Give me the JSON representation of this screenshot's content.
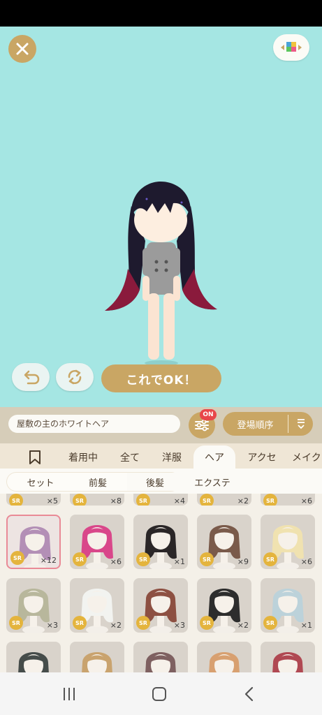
{
  "toolbar": {
    "ok_label": "これでOK！"
  },
  "name_field": {
    "value": "屋敷の主のホワイトヘア"
  },
  "filter": {
    "badge": "ON"
  },
  "sort": {
    "label": "登場順序"
  },
  "tabs": [
    {
      "label": "着用中"
    },
    {
      "label": "全て"
    },
    {
      "label": "洋服"
    },
    {
      "label": "ヘア",
      "active": true
    },
    {
      "label": "アクセ"
    },
    {
      "label": "メイク"
    }
  ],
  "subtabs": [
    {
      "label": "セット"
    },
    {
      "label": "前髪"
    },
    {
      "label": "後髪",
      "active": true
    },
    {
      "label": "エクステ"
    }
  ],
  "items_top": [
    {
      "rarity": "SR",
      "count": "×5"
    },
    {
      "rarity": "SR",
      "count": "×8"
    },
    {
      "rarity": "SR",
      "count": "×4"
    },
    {
      "rarity": "SR",
      "count": "×2"
    },
    {
      "rarity": "SR",
      "count": "×6"
    }
  ],
  "items_row1": [
    {
      "rarity": "SR",
      "count": "×12",
      "hair_color": "#b38fb6",
      "selected": true
    },
    {
      "rarity": "SR",
      "count": "×6",
      "hair_color": "#d9478a"
    },
    {
      "rarity": "SR",
      "count": "×1",
      "hair_color": "#2a2627"
    },
    {
      "rarity": "SR",
      "count": "×9",
      "hair_color": "#7a5a4a"
    },
    {
      "rarity": "SR",
      "count": "×6",
      "hair_color": "#f0e2b0"
    }
  ],
  "items_row2": [
    {
      "rarity": "SR",
      "count": "×3",
      "hair_color": "#b8b79c"
    },
    {
      "rarity": "SR",
      "count": "×2",
      "hair_color": "#f2f3f0"
    },
    {
      "rarity": "SR",
      "count": "×3",
      "hair_color": "#8d5042"
    },
    {
      "rarity": "SR",
      "count": "×2",
      "hair_color": "#2d2d2d"
    },
    {
      "rarity": "SR",
      "count": "×1",
      "hair_color": "#bcd2da"
    }
  ],
  "items_row3": [
    {
      "hair_color": "#454c4a"
    },
    {
      "hair_color": "#c9a36e"
    },
    {
      "hair_color": "#7e6060"
    },
    {
      "hair_color": "#d8a070"
    },
    {
      "hair_color": "#b04852"
    }
  ],
  "colors": {
    "accent": "#c9a664",
    "background": "#a5e6e3",
    "badge": "#e8464a",
    "selected_border": "#e98a96"
  }
}
